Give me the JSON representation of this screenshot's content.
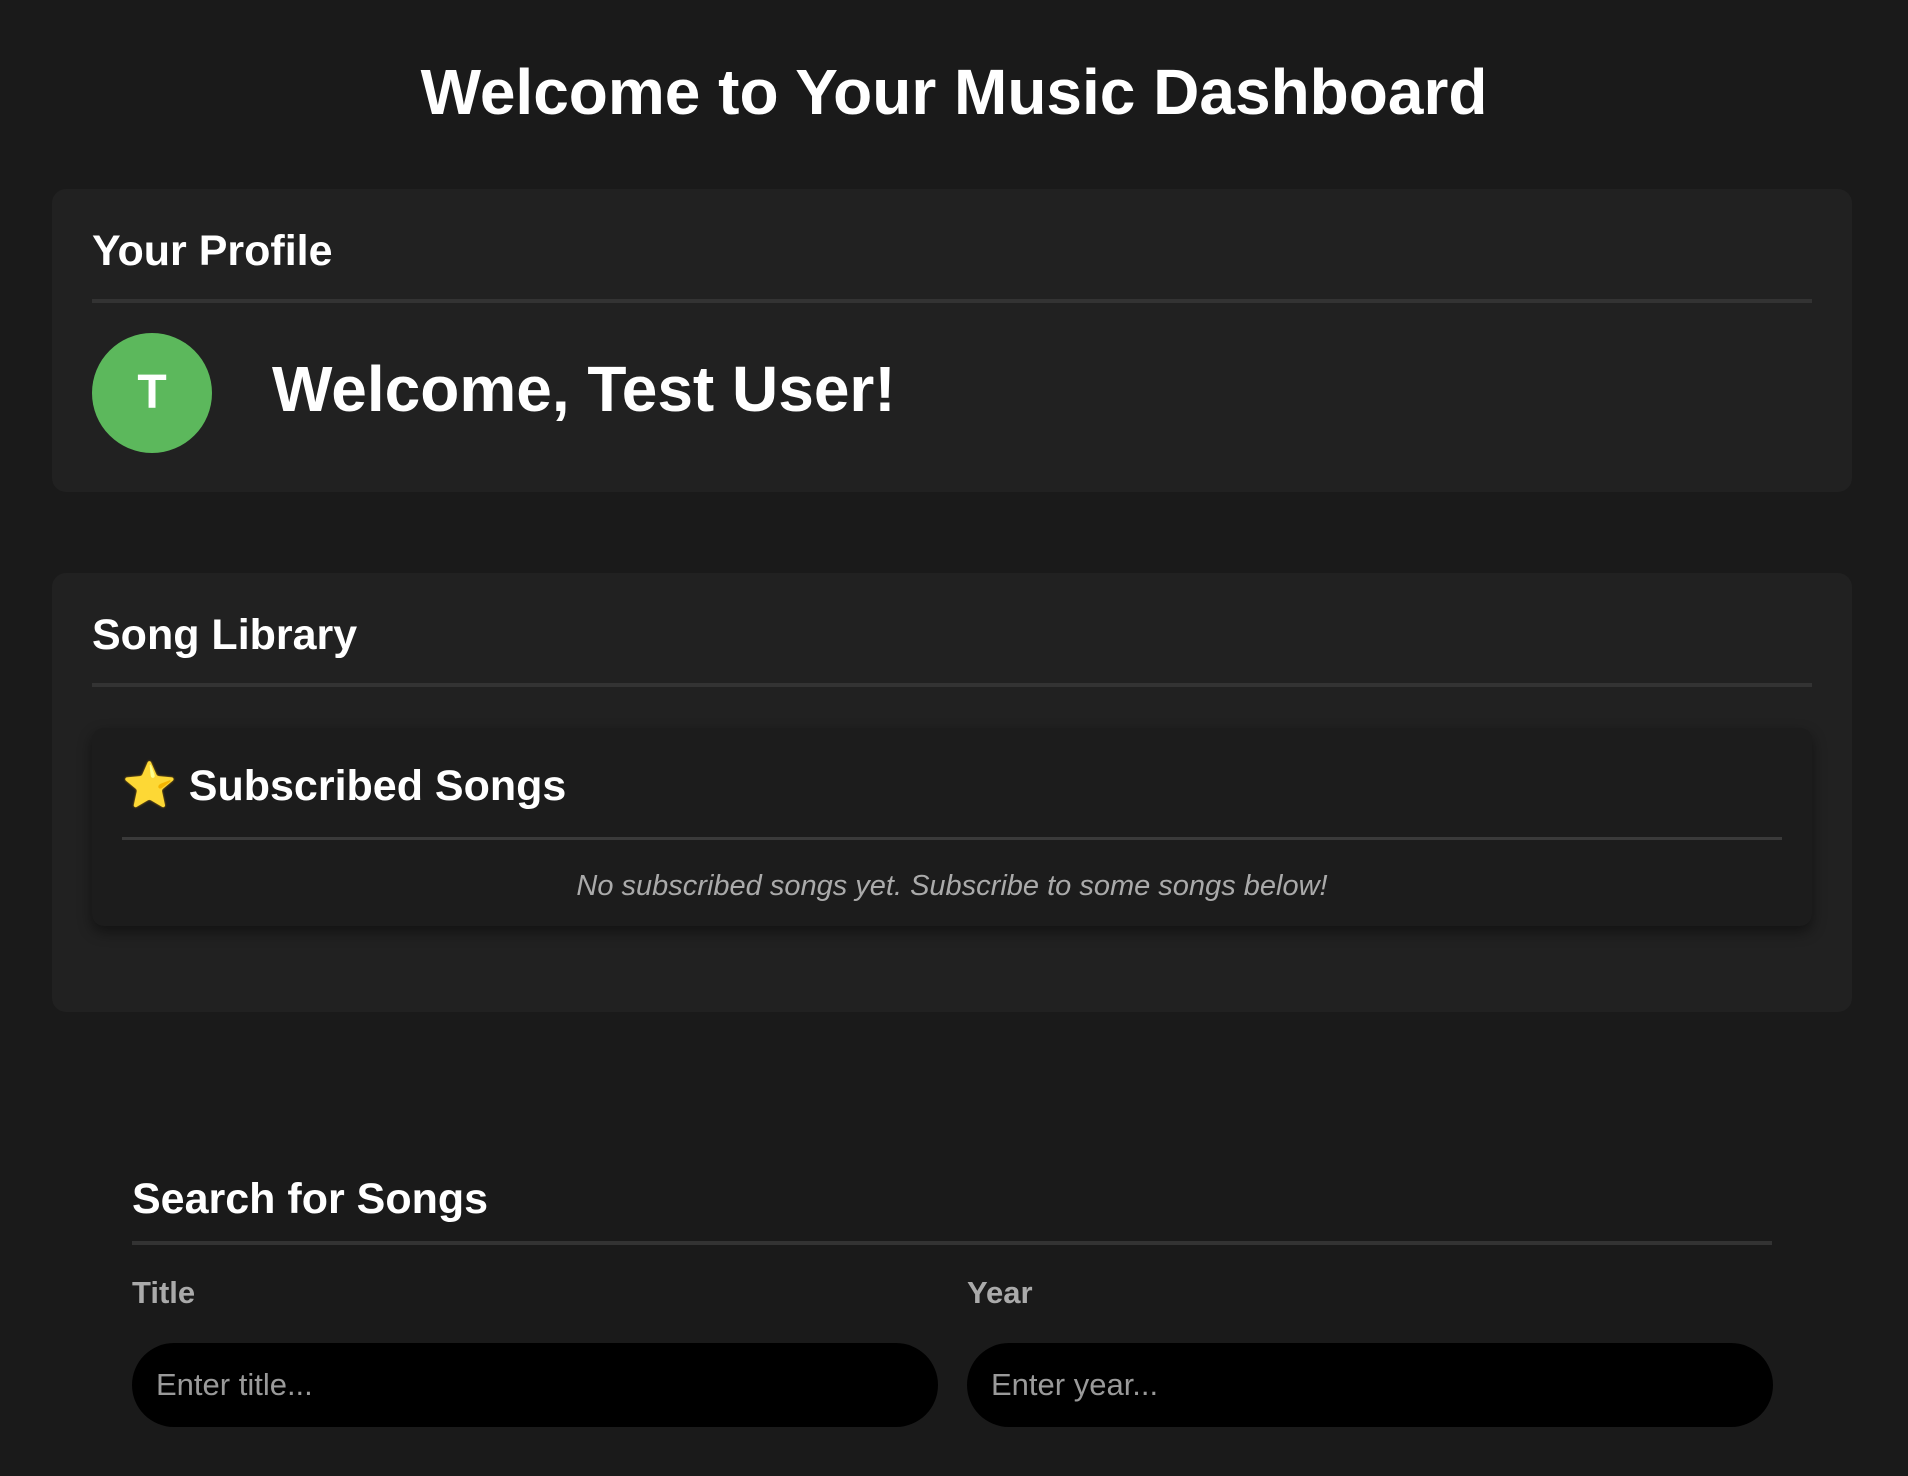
{
  "page": {
    "title": "Welcome to Your Music Dashboard"
  },
  "profile": {
    "heading": "Your Profile",
    "avatar_initial": "T",
    "avatar_color": "#5cb85c",
    "welcome": "Welcome, Test User!"
  },
  "library": {
    "heading": "Song Library",
    "subscribed": {
      "icon": "star-icon",
      "icon_glyph": "⭐",
      "heading": "Subscribed Songs",
      "empty_message": "No subscribed songs yet. Subscribe to some songs below!"
    }
  },
  "search": {
    "heading": "Search for Songs",
    "title_label": "Title",
    "title_placeholder": "Enter title...",
    "title_value": "",
    "year_label": "Year",
    "year_placeholder": "Enter year...",
    "year_value": ""
  }
}
